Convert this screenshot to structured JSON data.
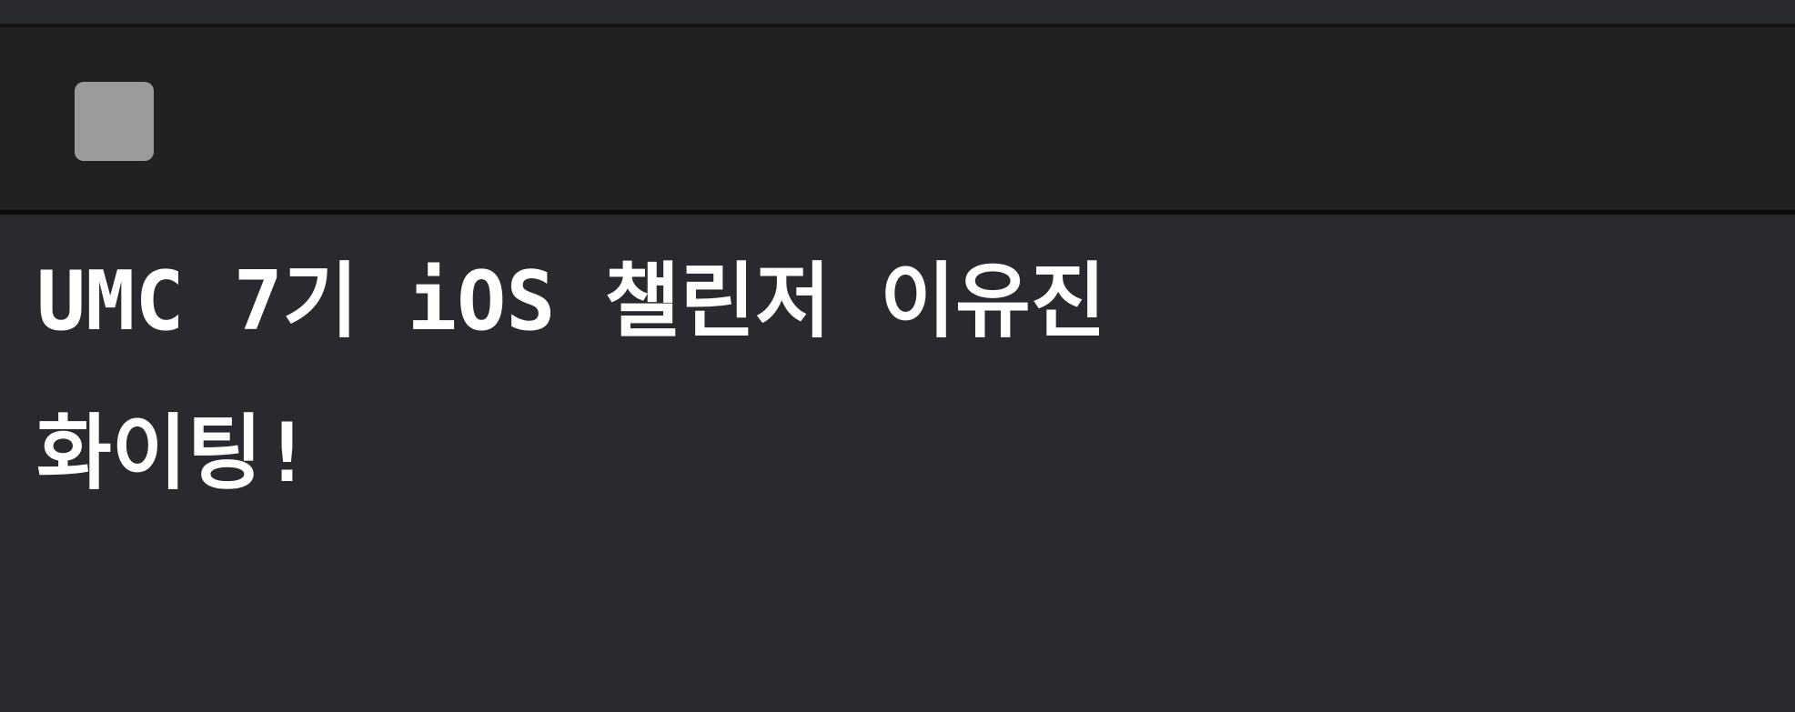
{
  "console": {
    "stop_icon": "stop-square-icon",
    "lines": [
      "UMC 7기 iOS 챌린저 이유진",
      "화이팅!"
    ]
  },
  "colors": {
    "background": "#292a30",
    "toolbar": "#222120",
    "stop_button": "#9b9b9b",
    "text": "#ffffff"
  }
}
